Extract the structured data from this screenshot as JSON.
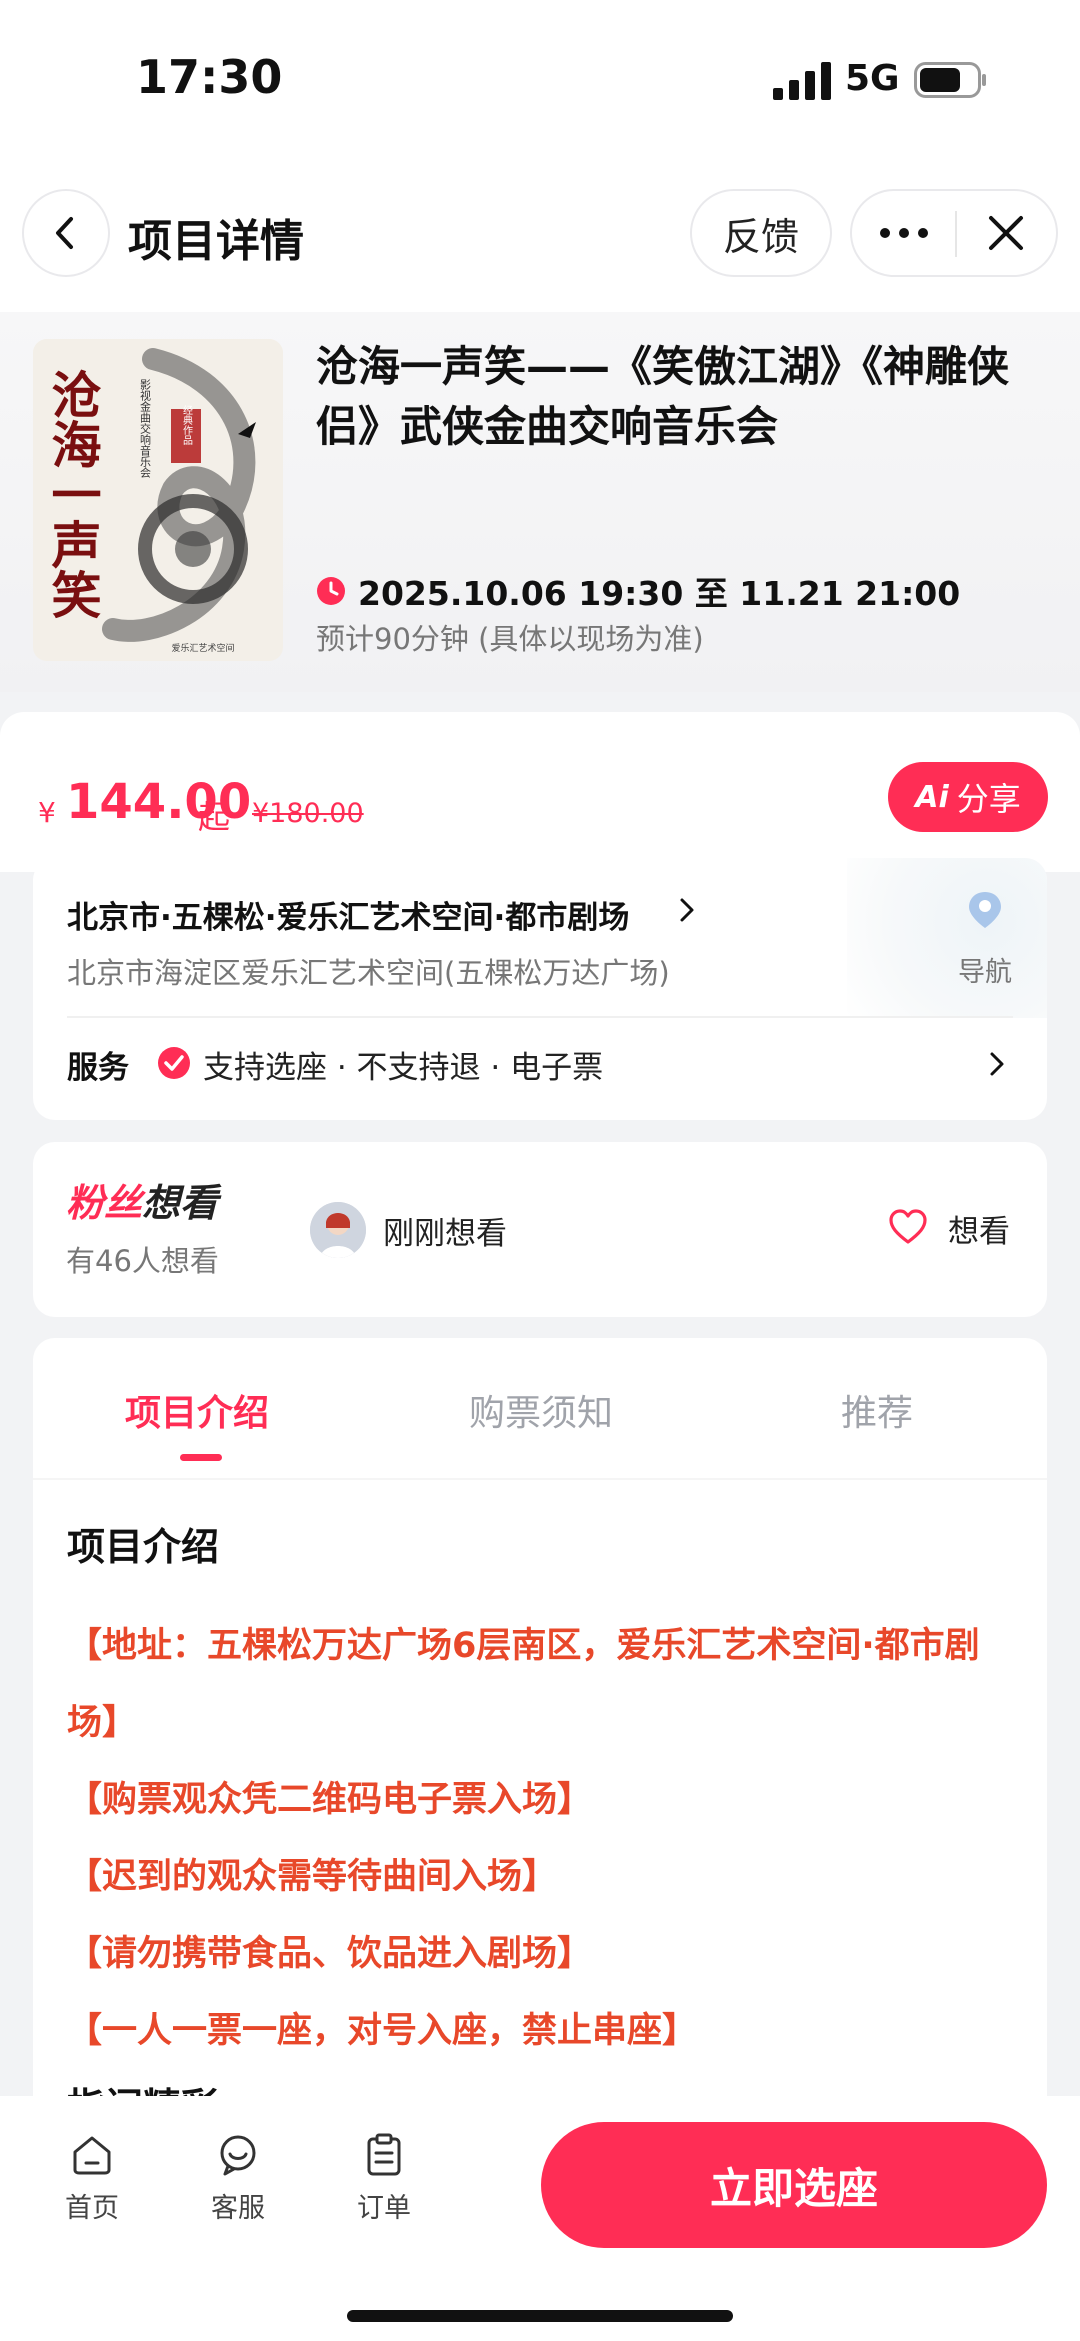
{
  "status_bar": {
    "time": "17:30",
    "network": "5G"
  },
  "navbar": {
    "title": "项目详情",
    "feedback_label": "反馈"
  },
  "show": {
    "title": "沧海一声笑——《笑傲江湖》《神雕侠侣》武侠金曲交响音乐会",
    "time": "2025.10.06 19:30 至 11.21 21:00",
    "duration": "预计90分钟 (具体以现场为准)",
    "poster": {
      "calligraphy": "沧海一声笑",
      "subtitle": "影视金曲交响音乐会",
      "seal": "经典作品",
      "footer": "爱乐汇艺术空间"
    }
  },
  "price": {
    "currency": "¥",
    "value": "144.00",
    "suffix": "起",
    "original": "¥180.00",
    "share_label": "分享",
    "ai_badge": "Ai"
  },
  "venue": {
    "name": "北京市·五棵松·爱乐汇艺术空间·都市剧场",
    "address": "北京市海淀区爱乐汇艺术空间(五棵松万达广场)",
    "nav_label": "导航",
    "service_label": "服务",
    "service_text": "支持选座 · 不支持退 · 电子票"
  },
  "fans": {
    "logo_part1": "粉丝",
    "logo_part2": "想看",
    "count_text": "有46人想看",
    "recent_text": "刚刚想看",
    "want_label": "想看"
  },
  "tabs": [
    {
      "label": "项目介绍",
      "active": true
    },
    {
      "label": "购票须知",
      "active": false
    },
    {
      "label": "推荐",
      "active": false
    }
  ],
  "detail": {
    "section_title": "项目介绍",
    "notes": [
      "【地址：五棵松万达广场6层南区，爱乐汇艺术空间·都市剧场】",
      "【购票观众凭二维码电子票入场】",
      "【迟到的观众需等待曲间入场】",
      "【请勿携带食品、饮品进入剧场】",
      "【一人一票一座，对号入座，禁止串座】"
    ],
    "next_heading": "指间精彩"
  },
  "bottom_bar": {
    "items": [
      {
        "label": "首页",
        "icon": "home-icon"
      },
      {
        "label": "客服",
        "icon": "customer-service-icon"
      },
      {
        "label": "订单",
        "icon": "order-icon"
      }
    ],
    "buy_label": "立即选座"
  },
  "colors": {
    "accent": "#ff2d55",
    "note_red": "#e8482a"
  }
}
